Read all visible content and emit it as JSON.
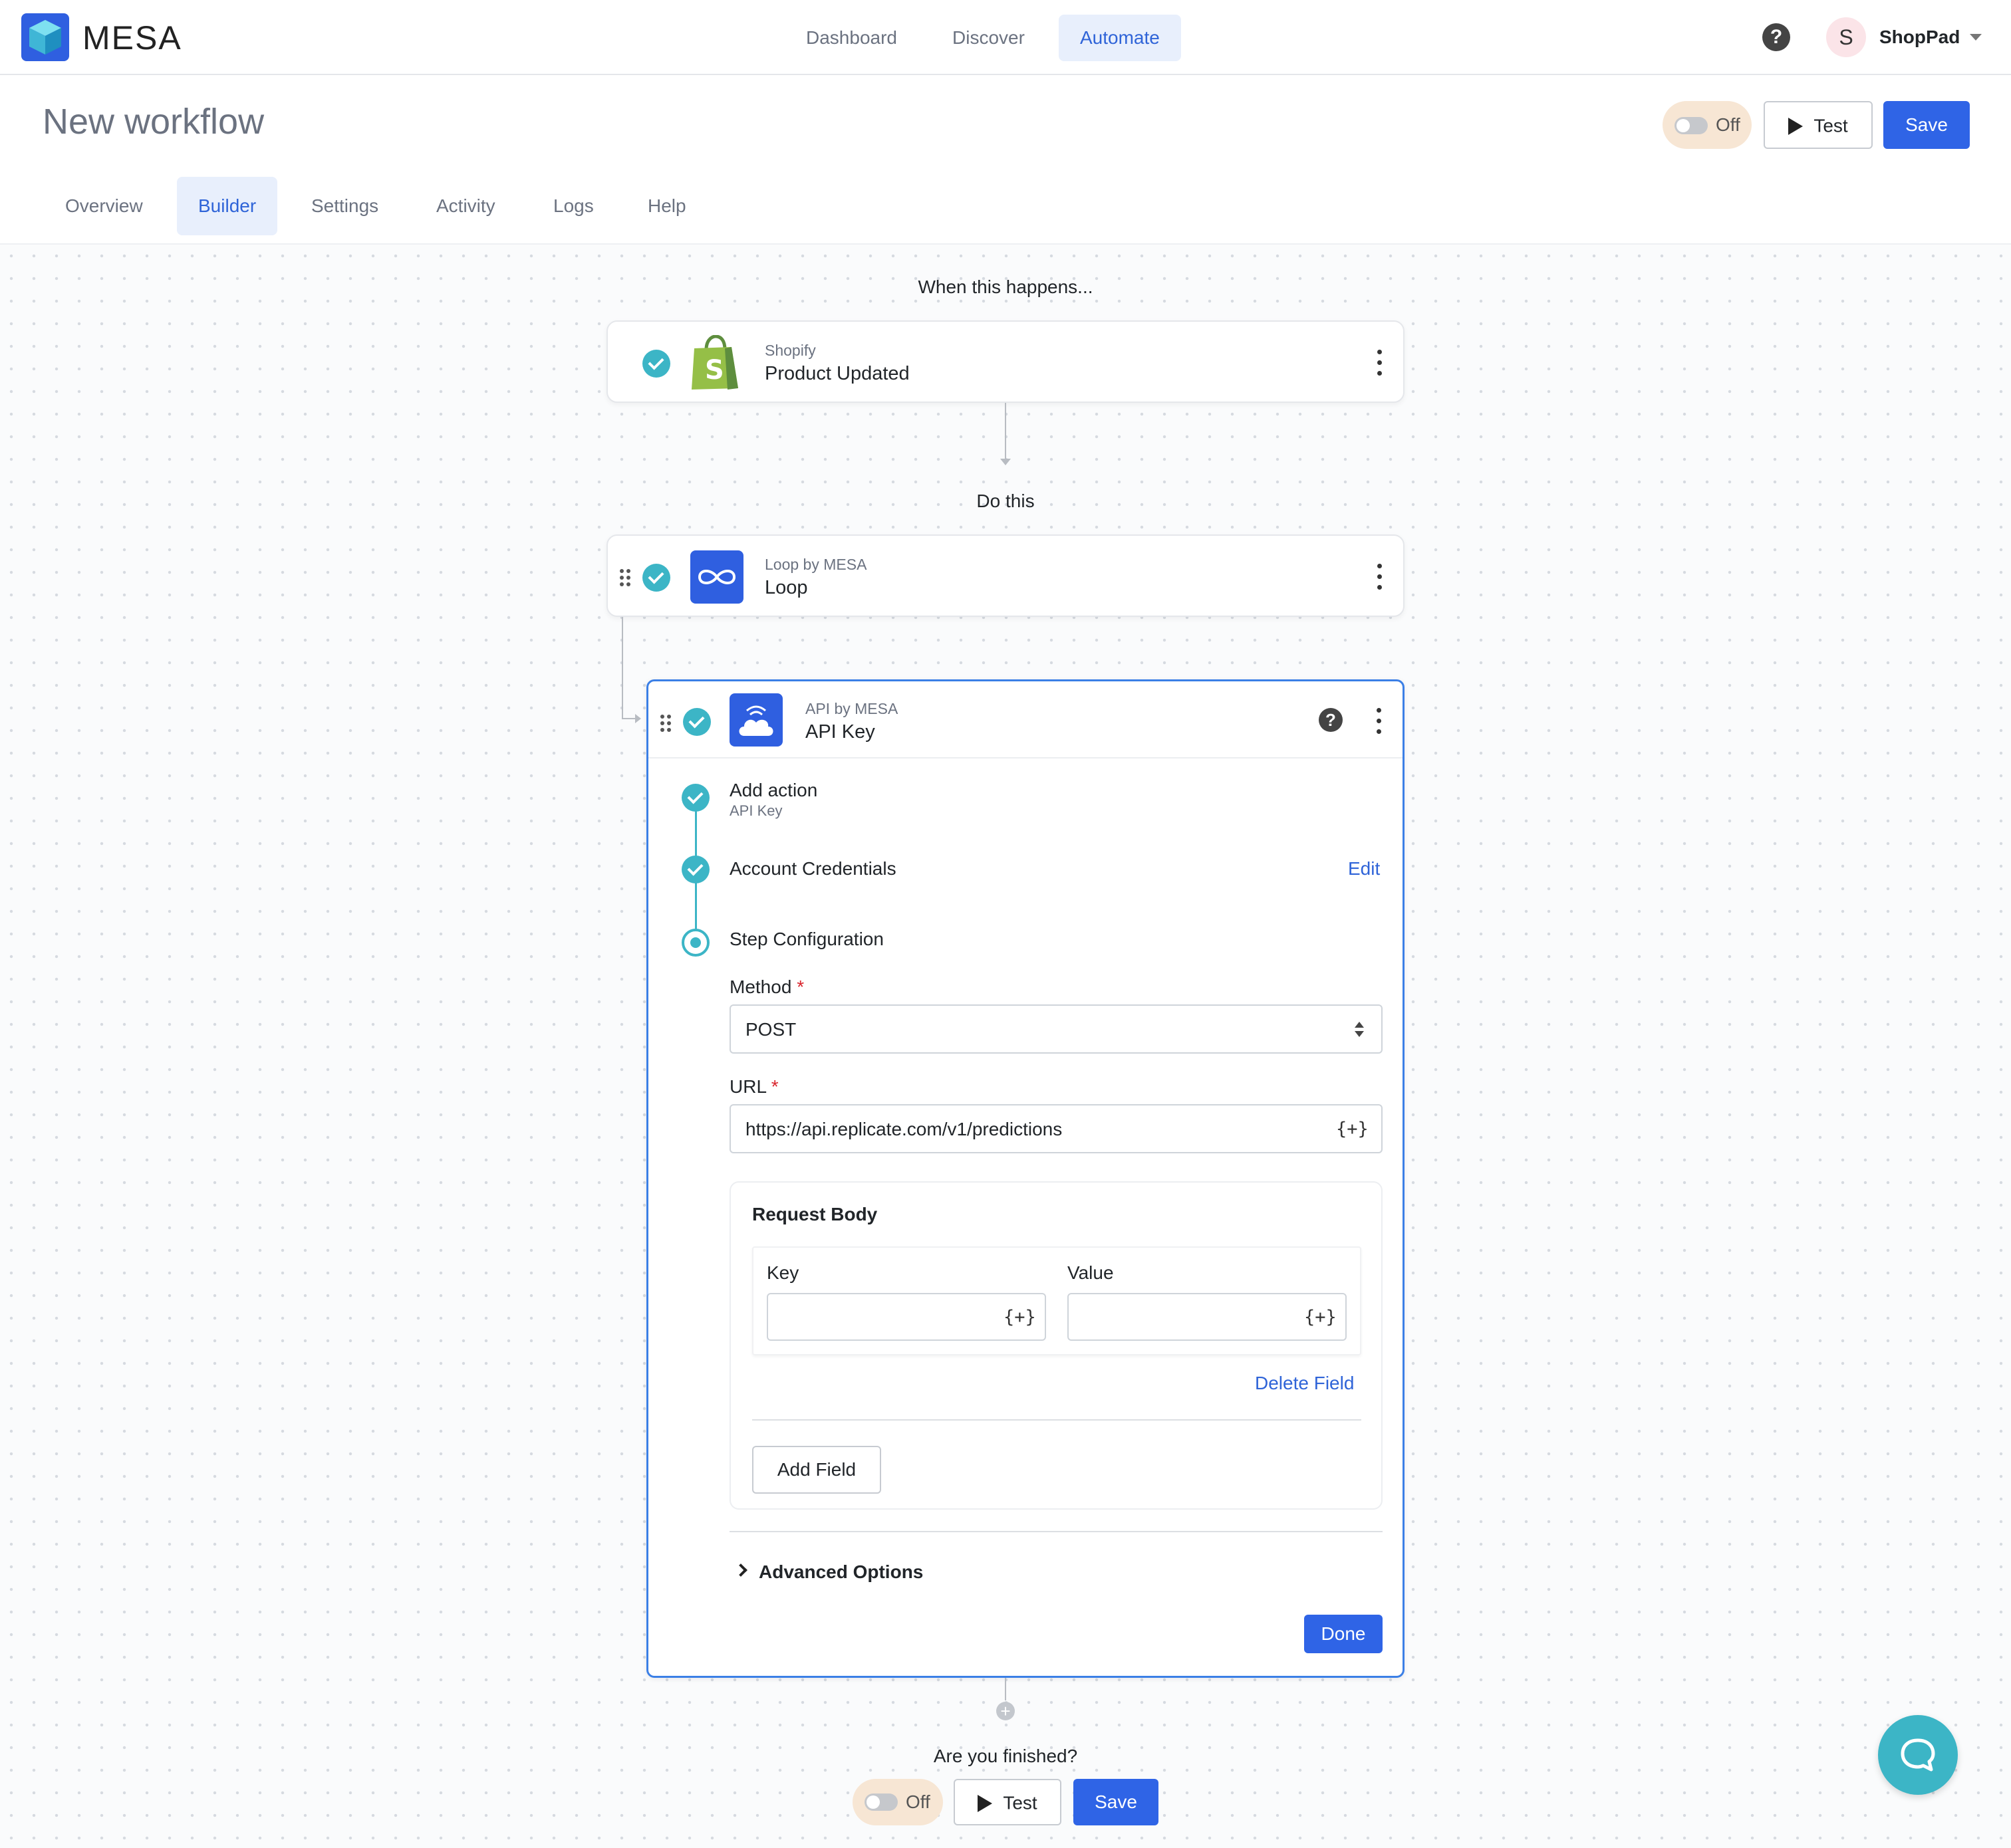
{
  "header": {
    "brand": "MESA",
    "nav": [
      "Dashboard",
      "Discover",
      "Automate"
    ],
    "account_initial": "S",
    "account_name": "ShopPad"
  },
  "page": {
    "title": "New workflow",
    "toggle_label": "Off",
    "test_label": "Test",
    "save_label": "Save"
  },
  "tabs": [
    "Overview",
    "Builder",
    "Settings",
    "Activity",
    "Logs",
    "Help"
  ],
  "builder": {
    "trigger_heading": "When this happens...",
    "trigger": {
      "app": "Shopify",
      "name": "Product Updated"
    },
    "action_heading": "Do this",
    "loop": {
      "app": "Loop by MESA",
      "name": "Loop"
    },
    "api": {
      "app": "API by MESA",
      "name": "API Key",
      "steps": {
        "add_action": "Add action",
        "add_action_sub": "API Key",
        "credentials": "Account Credentials",
        "edit": "Edit",
        "config": "Step Configuration"
      },
      "method_label": "Method",
      "method_value": "POST",
      "url_label": "URL",
      "url_value": "https://api.replicate.com/v1/predictions",
      "brace": "{+}",
      "request_body": {
        "title": "Request Body",
        "key_label": "Key",
        "value_label": "Value",
        "delete_field": "Delete Field",
        "add_field": "Add Field"
      },
      "advanced_options": "Advanced Options",
      "done": "Done"
    },
    "finished_prompt": "Are you finished?"
  },
  "colors": {
    "primary": "#2f64e6",
    "teal": "#3cb5c6",
    "shopify_green": "#95bf47",
    "mesa_blue": "#2f5fe0"
  },
  "icons": [
    "mesa-logo-icon",
    "help-icon",
    "caret-down-icon",
    "play-icon",
    "check-icon",
    "shopify-icon",
    "infinity-icon",
    "cloud-icon",
    "kebab-icon",
    "drag-handle-icon",
    "sort-arrows-icon",
    "chevron-right-icon",
    "add-step-icon",
    "chat-bubble-icon"
  ]
}
